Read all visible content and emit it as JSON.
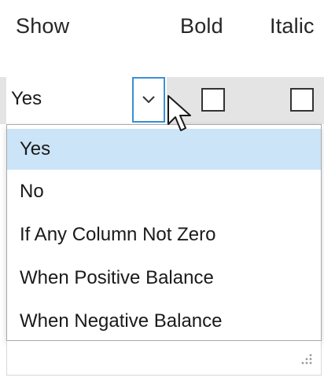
{
  "columns": {
    "show": "Show",
    "bold": "Bold",
    "italic": "Italic"
  },
  "show_combo": {
    "value": "Yes",
    "open": true
  },
  "dropdown": {
    "selected_index": 0,
    "options": [
      "Yes",
      "No",
      "If Any Column Not Zero",
      "When Positive Balance",
      "When Negative Balance"
    ]
  },
  "checkboxes": {
    "bold_checked": false,
    "italic_checked": false
  },
  "icons": {
    "combo_arrow": "chevron-down-icon",
    "cursor": "mouse-pointer-icon",
    "resize": "resize-grip-icon"
  },
  "colors": {
    "combo_focus_border": "#3c8fd6",
    "selected_item_bg": "#cce4f7",
    "row_strip_bg": "#e4e4e4"
  }
}
